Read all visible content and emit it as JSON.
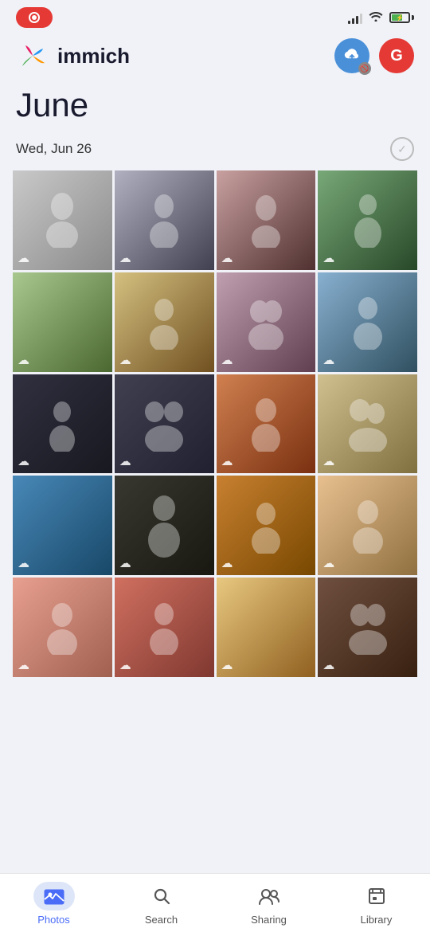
{
  "app": {
    "title": "immich",
    "avatar_letter": "G"
  },
  "status_bar": {
    "signal_bars": [
      4,
      6,
      9,
      11,
      13
    ],
    "battery_percent": 65
  },
  "timeline": {
    "month": "June",
    "date_label": "Wed, Jun 26"
  },
  "photos": [
    {
      "id": 1,
      "color_class": "p1",
      "cloud": true
    },
    {
      "id": 2,
      "color_class": "p2",
      "cloud": true
    },
    {
      "id": 3,
      "color_class": "p3",
      "cloud": true
    },
    {
      "id": 4,
      "color_class": "p4",
      "cloud": true
    },
    {
      "id": 5,
      "color_class": "p5",
      "cloud": true
    },
    {
      "id": 6,
      "color_class": "p6",
      "cloud": true
    },
    {
      "id": 7,
      "color_class": "p7",
      "cloud": true
    },
    {
      "id": 8,
      "color_class": "p8",
      "cloud": true
    },
    {
      "id": 9,
      "color_class": "p9",
      "cloud": true
    },
    {
      "id": 10,
      "color_class": "p10",
      "cloud": true
    },
    {
      "id": 11,
      "color_class": "p11",
      "cloud": true
    },
    {
      "id": 12,
      "color_class": "p12",
      "cloud": true
    },
    {
      "id": 13,
      "color_class": "p13",
      "cloud": true
    },
    {
      "id": 14,
      "color_class": "p14",
      "cloud": true
    },
    {
      "id": 15,
      "color_class": "p15",
      "cloud": true
    },
    {
      "id": 16,
      "color_class": "p16",
      "cloud": true
    },
    {
      "id": 17,
      "color_class": "p17",
      "cloud": true
    },
    {
      "id": 18,
      "color_class": "p18",
      "cloud": true
    },
    {
      "id": 19,
      "color_class": "p19",
      "cloud": true
    },
    {
      "id": 20,
      "color_class": "p20",
      "cloud": true
    }
  ],
  "nav": {
    "items": [
      {
        "id": "photos",
        "label": "Photos",
        "icon": "🖼",
        "active": true
      },
      {
        "id": "search",
        "label": "Search",
        "icon": "🔍",
        "active": false
      },
      {
        "id": "sharing",
        "label": "Sharing",
        "icon": "👥",
        "active": false
      },
      {
        "id": "library",
        "label": "Library",
        "icon": "📑",
        "active": false
      }
    ]
  }
}
